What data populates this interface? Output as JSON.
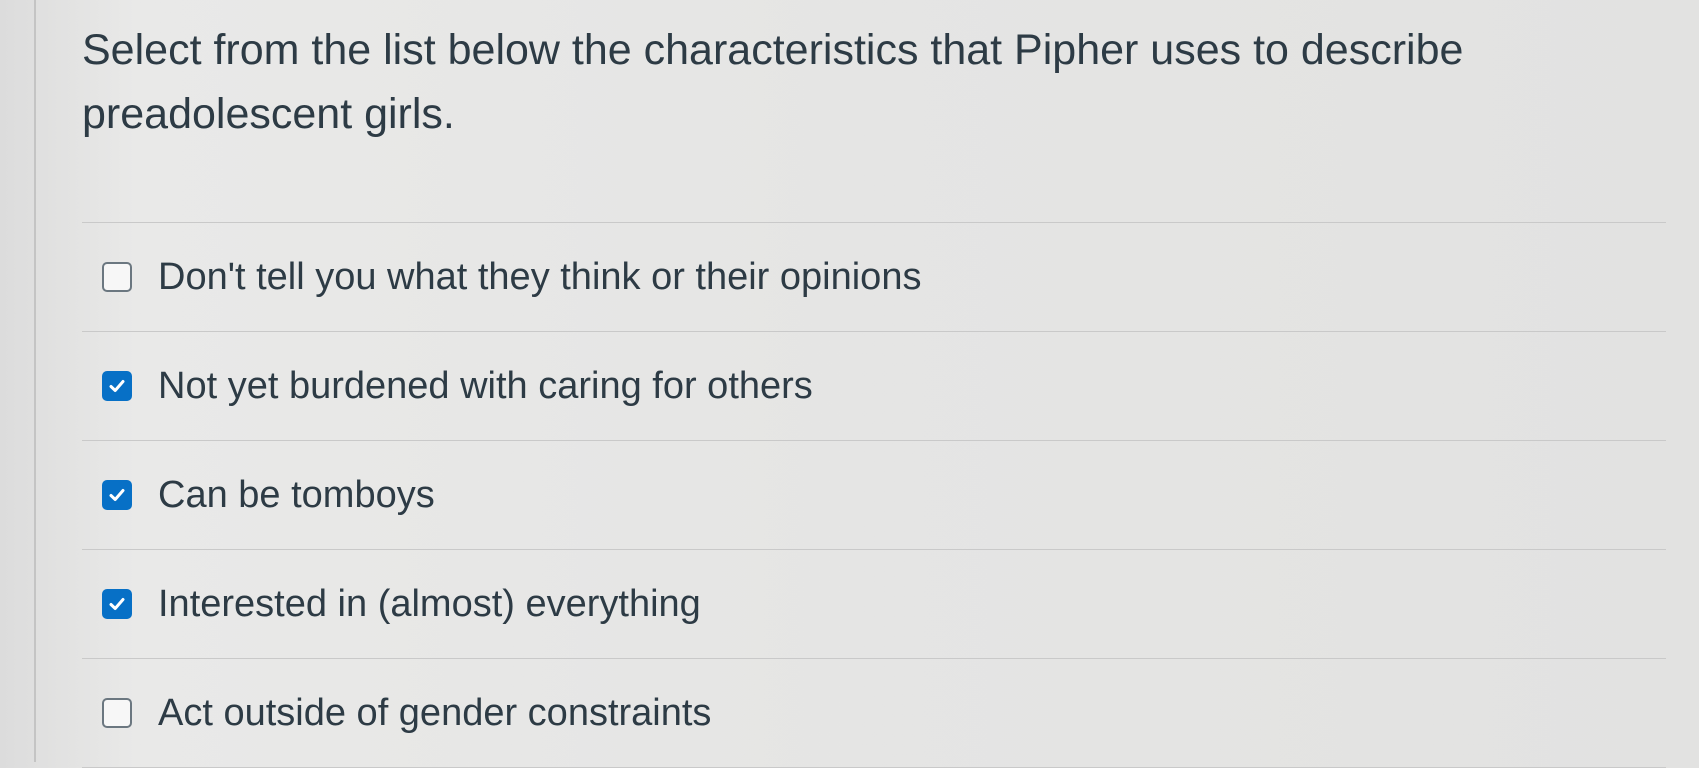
{
  "question": {
    "text": "Select from the list below the characteristics that Pipher uses to describe preadolescent girls."
  },
  "answers": [
    {
      "label": "Don't tell you what they think or their opinions",
      "checked": false
    },
    {
      "label": "Not yet burdened with caring for others",
      "checked": true
    },
    {
      "label": "Can be tomboys",
      "checked": true
    },
    {
      "label": "Interested in (almost) everything",
      "checked": true
    },
    {
      "label": "Act outside of gender constraints",
      "checked": false
    }
  ],
  "colors": {
    "checkbox_checked": "#0770c6",
    "text": "#2d3b45"
  }
}
